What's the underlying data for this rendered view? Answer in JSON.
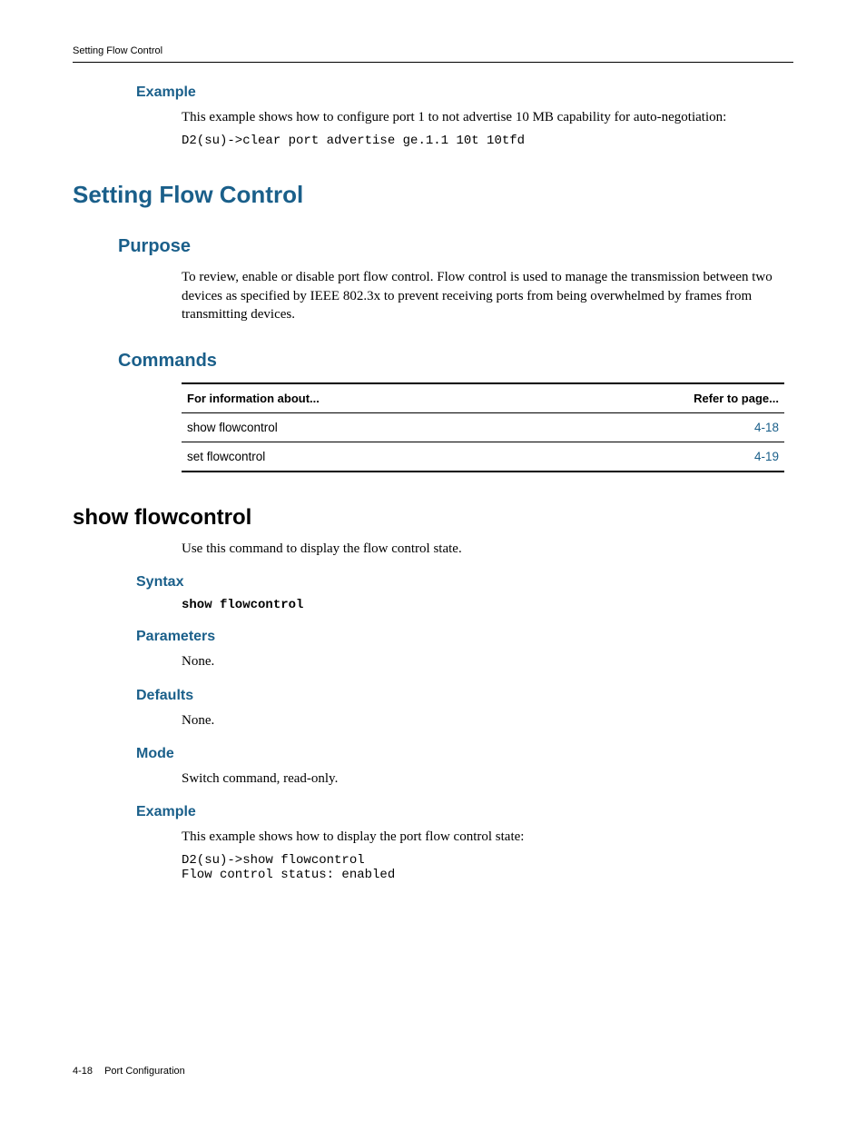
{
  "header": {
    "running_title": "Setting Flow Control"
  },
  "example_top": {
    "heading": "Example",
    "text": "This example shows how to configure port 1 to not advertise 10 MB capability for auto-negotiation:",
    "code": "D2(su)->clear port advertise ge.1.1 10t 10tfd"
  },
  "section": {
    "title": "Setting Flow Control",
    "purpose": {
      "heading": "Purpose",
      "text": "To review, enable or disable port flow control. Flow control is used to manage the transmission between two devices as specified by IEEE 802.3x to prevent receiving ports from being overwhelmed by frames from transmitting devices."
    },
    "commands": {
      "heading": "Commands",
      "table": {
        "col1": "For information about...",
        "col2": "Refer to page...",
        "rows": [
          {
            "about": "show flowcontrol",
            "page": "4-18"
          },
          {
            "about": "set flowcontrol",
            "page": "4-19"
          }
        ]
      }
    }
  },
  "command": {
    "name": "show flowcontrol",
    "intro": "Use this command to display the flow control state.",
    "syntax": {
      "heading": "Syntax",
      "code": "show flowcontrol"
    },
    "parameters": {
      "heading": "Parameters",
      "text": "None."
    },
    "defaults": {
      "heading": "Defaults",
      "text": "None."
    },
    "mode": {
      "heading": "Mode",
      "text": "Switch command, read-only."
    },
    "example": {
      "heading": "Example",
      "text": "This example shows how to display the port flow control state:",
      "code": "D2(su)->show flowcontrol \nFlow control status: enabled"
    }
  },
  "footer": {
    "page_num": "4-18",
    "chapter": "Port Configuration"
  }
}
